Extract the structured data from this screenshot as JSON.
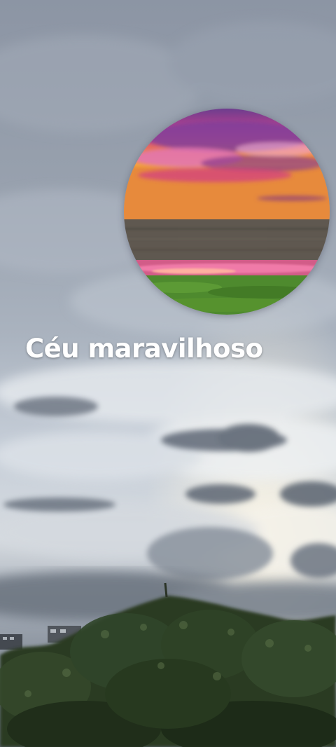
{
  "caption": {
    "text": "Céu maravilhoso",
    "color": "#ffffff"
  },
  "scene": {
    "background": "overcast-sky-with-clouds",
    "foreground": "tree-canopy-silhouette",
    "inset": "sunset-over-wetland",
    "colors": {
      "sky_top": "#8e97a6",
      "sky_mid": "#b9c3cf",
      "sky_bright": "#e4e9ee",
      "trees": "#26361f",
      "sunset_magenta": "#c93a86",
      "sunset_orange": "#f29a2e",
      "grass": "#4f8a2c"
    }
  }
}
